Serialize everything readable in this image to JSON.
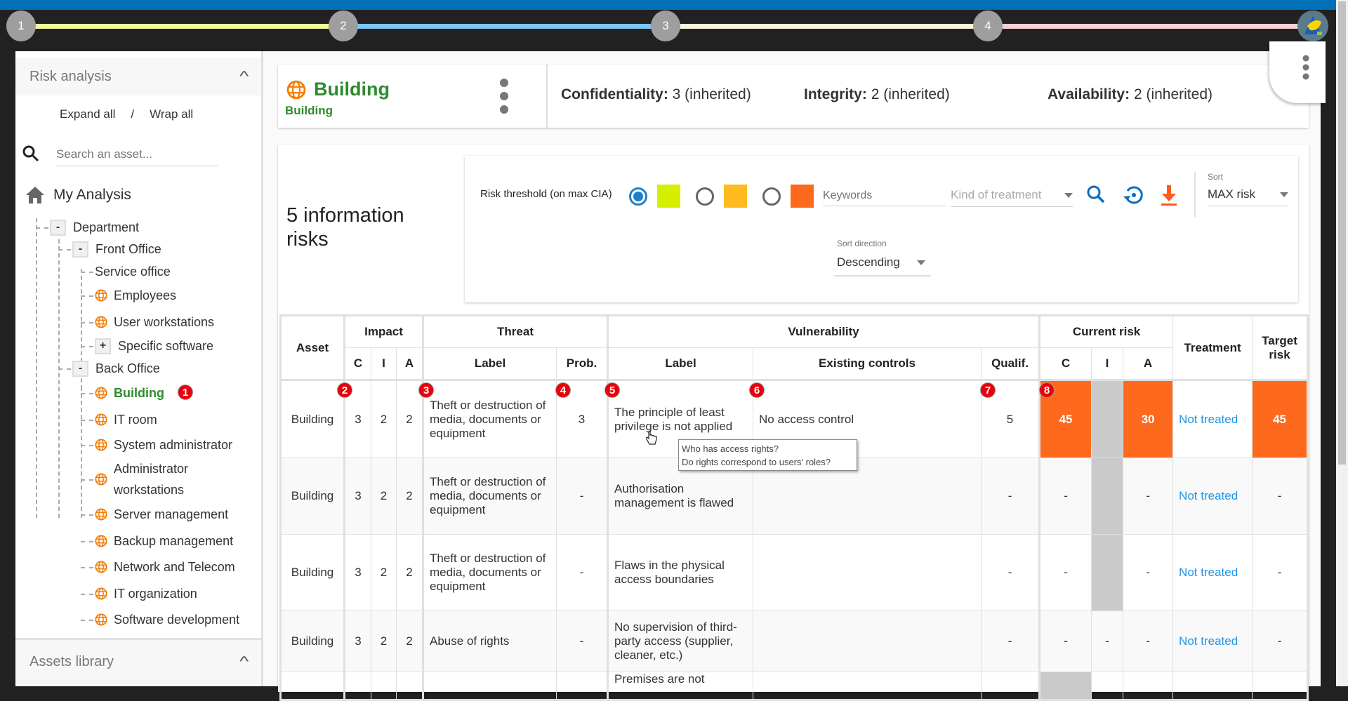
{
  "stepper": {
    "steps": [
      "1",
      "2",
      "3",
      "4"
    ],
    "colors": [
      "#f4fa9c",
      "#7cc4f8",
      "#fdf3dc",
      "#fccfd4"
    ]
  },
  "sidebar": {
    "risk_analysis_title": "Risk analysis",
    "expand_all": "Expand all",
    "separator": "/",
    "wrap_all": "Wrap all",
    "search_placeholder": "Search an asset...",
    "root_label": "My Analysis",
    "tree": [
      {
        "label": "Department",
        "toggle": "-"
      },
      {
        "label": "Front Office",
        "toggle": "-"
      },
      {
        "label": "Service office"
      },
      {
        "label": "Employees"
      },
      {
        "label": "User workstations"
      },
      {
        "label": "Specific software",
        "toggle": "+"
      },
      {
        "label": "Back Office",
        "toggle": "-"
      },
      {
        "label": "Building",
        "selected": true,
        "badge": "1"
      },
      {
        "label": "IT room"
      },
      {
        "label": "System administrator"
      },
      {
        "label": "Administrator workstations"
      },
      {
        "label": "Server management"
      },
      {
        "label": "Backup management"
      },
      {
        "label": "Network and Telecom"
      },
      {
        "label": "IT organization"
      },
      {
        "label": "Software development"
      }
    ],
    "assets_library_title": "Assets library"
  },
  "header": {
    "title": "Building",
    "subtitle": "Building",
    "confidentiality_label": "Confidentiality:",
    "confidentiality_value": "3 (inherited)",
    "integrity_label": "Integrity:",
    "integrity_value": "2 (inherited)",
    "availability_label": "Availability:",
    "availability_value": "2 (inherited)"
  },
  "filters": {
    "count_text": "5 information risks",
    "threshold_label": "Risk threshold (on max CIA)",
    "threshold_colors": [
      "#d6ef00",
      "#fdbb1e",
      "#fd6a1e"
    ],
    "selected_threshold": 0,
    "keywords_placeholder": "Keywords",
    "treatment_placeholder": "Kind of treatment",
    "sort_label": "Sort",
    "sort_value": "MAX risk",
    "sort_direction_label": "Sort direction",
    "sort_direction_value": "Descending"
  },
  "table": {
    "headers": {
      "asset": "Asset",
      "impact": "Impact",
      "threat": "Threat",
      "vulnerability": "Vulnerability",
      "current_risk": "Current risk",
      "treatment": "Treatment",
      "target_risk": "Target risk",
      "c": "C",
      "i": "I",
      "a": "A",
      "label": "Label",
      "prob": "Prob.",
      "vuln_label": "Label",
      "existing_controls": "Existing controls",
      "qualif": "Qualif."
    },
    "badges": [
      "2",
      "3",
      "4",
      "5",
      "6",
      "7",
      "8"
    ],
    "risk_color": "#fd6a1e",
    "rows": [
      {
        "asset": "Building",
        "c": "3",
        "i": "2",
        "a": "2",
        "threat": "Theft or destruction of media, documents or equipment",
        "prob": "3",
        "vuln": "The principle of least privilege is not applied",
        "controls": "No access control",
        "qualif": "5",
        "rc": "45",
        "ri": "",
        "ra": "30",
        "treatment": "Not treated",
        "target": "45"
      },
      {
        "asset": "Building",
        "c": "3",
        "i": "2",
        "a": "2",
        "threat": "Theft or destruction of media, documents or equipment",
        "prob": "-",
        "vuln": "Authorisation management is flawed",
        "controls": "",
        "qualif": "-",
        "rc": "-",
        "ri": "",
        "ra": "-",
        "treatment": "Not treated",
        "target": "-"
      },
      {
        "asset": "Building",
        "c": "3",
        "i": "2",
        "a": "2",
        "threat": "Theft or destruction of media, documents or equipment",
        "prob": "-",
        "vuln": "Flaws in the physical access boundaries",
        "controls": "",
        "qualif": "-",
        "rc": "-",
        "ri": "",
        "ra": "-",
        "treatment": "Not treated",
        "target": "-"
      },
      {
        "asset": "Building",
        "c": "3",
        "i": "2",
        "a": "2",
        "threat": "Abuse of rights",
        "prob": "-",
        "vuln": "No supervision of third-party access (supplier, cleaner, etc.)",
        "controls": "",
        "qualif": "-",
        "rc": "-",
        "ri": "-",
        "ra": "-",
        "treatment": "Not treated",
        "target": "-"
      },
      {
        "asset": "",
        "c": "",
        "i": "",
        "a": "",
        "threat": "",
        "prob": "",
        "vuln": "Premises are not",
        "controls": "",
        "qualif": "",
        "rc": "",
        "ri": "",
        "ra": "",
        "treatment": "",
        "target": ""
      }
    ],
    "tooltip": [
      "Who has access rights?",
      "Do rights correspond to users' roles?"
    ]
  }
}
